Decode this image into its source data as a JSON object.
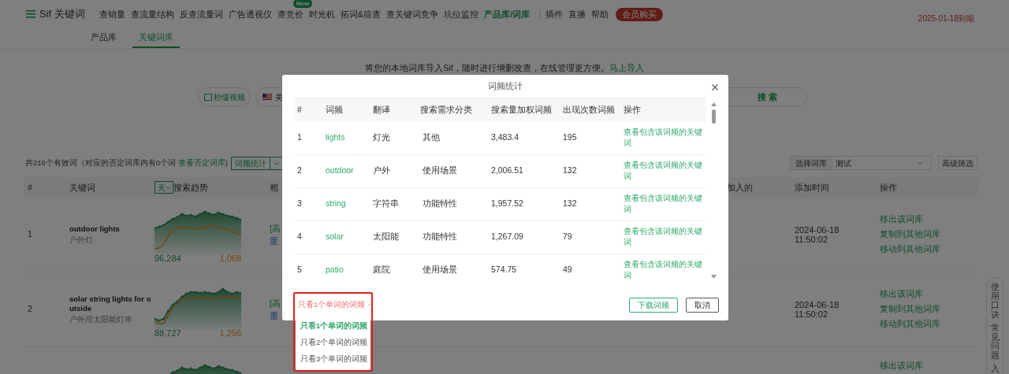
{
  "nav": {
    "logo": "Sif 关键词",
    "items": [
      {
        "label": "查销量",
        "selected": false
      },
      {
        "label": "查流量结构",
        "selected": false
      },
      {
        "label": "反查流量词",
        "selected": false
      },
      {
        "label": "广告透视仪",
        "selected": false
      },
      {
        "label": "查竞价",
        "selected": false,
        "badge": "New"
      },
      {
        "label": "时光机",
        "selected": false
      },
      {
        "label": "拓词&筛查",
        "selected": false
      },
      {
        "label": "查关键词竞争",
        "selected": false
      },
      {
        "label": "坑位监控",
        "selected": false
      },
      {
        "label": "产品库/词库",
        "selected": true
      }
    ],
    "extra_items": [
      "插件",
      "直播",
      "帮助"
    ],
    "member_button": "会员购买",
    "expiry": "2025-01-18到期"
  },
  "subnav": [
    {
      "label": "产品库",
      "selected": false
    },
    {
      "label": "关键词库",
      "selected": true
    }
  ],
  "import_banner": {
    "text": "将您的本地词库导入Sif，随时进行增删改查，在线管理更方便。",
    "link": "马上导入"
  },
  "search_bar": {
    "video_button": "秒懂视频",
    "country": "美",
    "search_button": "搜 索"
  },
  "summary": {
    "text": "共216个有效词（对应的否定词库内有0个词",
    "link": "查看否定词库",
    "end": ")"
  },
  "toolbar": {
    "word_freq_button": "词频统计",
    "library_label": "选择词库",
    "library_value": "测试",
    "advanced_filter": "高级筛选"
  },
  "table": {
    "columns": [
      "#",
      "关键词",
      "搜索趋势",
      "相",
      "加入的",
      "添加时间",
      "操作"
    ],
    "period": "天",
    "rows": [
      {
        "index": "1",
        "keyword": "outdoor lights",
        "translation": "户外灯",
        "trend_start": "96,284",
        "trend_end": "1,068",
        "tag": "[高",
        "link": "重",
        "added": "2024-06-18 11:50:02",
        "actions": [
          "移出该词库",
          "复制到其他词库",
          "移动到其他词库"
        ]
      },
      {
        "index": "2",
        "keyword": "solar string lights for outside",
        "translation": "户外用太阳能灯串",
        "trend_start": "88,727",
        "trend_end": "1,256",
        "tag": "[高",
        "link": "重",
        "added": "2024-06-18 11:50:02",
        "actions": [
          "移出该词库",
          "复制到其他词库",
          "移动到其他词库"
        ]
      },
      {
        "actions": [
          "移出该词库"
        ]
      }
    ]
  },
  "side_tab": [
    "使用口诀",
    "常见问题",
    "入"
  ],
  "modal": {
    "title": "词频统计",
    "columns": [
      "#",
      "词频",
      "翻译",
      "搜索需求分类",
      "搜索量加权词频",
      "出现次数词频",
      "操作"
    ],
    "rows": [
      {
        "index": "1",
        "word": "lights",
        "translation": "灯光",
        "category": "其他",
        "weighted": "3,483.4",
        "count": "195",
        "action": "查看包含该词频的关键词"
      },
      {
        "index": "2",
        "word": "outdoor",
        "translation": "户外",
        "category": "使用场景",
        "weighted": "2,006.51",
        "count": "132",
        "action": "查看包含该词频的关键词"
      },
      {
        "index": "3",
        "word": "string",
        "translation": "字符串",
        "category": "功能特性",
        "weighted": "1,957.52",
        "count": "132",
        "action": "查看包含该词频的关键词"
      },
      {
        "index": "4",
        "word": "solar",
        "translation": "太阳能",
        "category": "功能特性",
        "weighted": "1,267.09",
        "count": "79",
        "action": "查看包含该词频的关键词"
      },
      {
        "index": "5",
        "word": "patio",
        "translation": "庭院",
        "category": "使用场景",
        "weighted": "574.75",
        "count": "49",
        "action": "查看包含该词频的关键词"
      }
    ],
    "filter": {
      "value": "只看1个单词的词频",
      "expanded": true,
      "options": [
        {
          "label": "只看1个单词的词频",
          "selected": true
        },
        {
          "label": "只看2个单词的词频",
          "selected": false
        },
        {
          "label": "只看3个单词的词频",
          "selected": false
        }
      ]
    },
    "download_button": "下载词频",
    "cancel_button": "取消"
  }
}
